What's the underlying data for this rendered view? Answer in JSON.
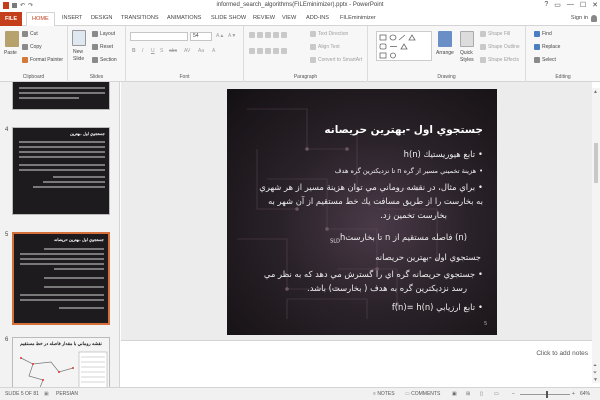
{
  "window": {
    "title": "informed_search_algorithms(FILEminimizer).pptx - PowerPoint",
    "controls": [
      "?",
      "▭",
      "—",
      "☐",
      "✕"
    ]
  },
  "tabs": [
    "FILE",
    "HOME",
    "INSERT",
    "DESIGN",
    "TRANSITIONS",
    "ANIMATIONS",
    "SLIDE SHOW",
    "REVIEW",
    "VIEW",
    "ADD-INS",
    "FILEminimizer"
  ],
  "account": {
    "sign_in": "Sign in"
  },
  "ribbon": {
    "clipboard": {
      "label": "Clipboard",
      "paste": "Paste",
      "cut": "Cut",
      "copy": "Copy",
      "format_painter": "Format Painter"
    },
    "slides": {
      "label": "Slides",
      "new_slide_line1": "New",
      "new_slide_line2": "Slide",
      "layout": "Layout",
      "reset": "Reset",
      "section": "Section"
    },
    "font": {
      "label": "Font",
      "font_size": "54",
      "bold": "B",
      "italic": "I",
      "underline": "U",
      "strike": "S",
      "shadow": "abc",
      "spacing": "AV",
      "case": "Aa",
      "color": "A"
    },
    "paragraph": {
      "label": "Paragraph",
      "text_direction": "Text Direction",
      "align_text": "Align Text",
      "convert_smartart": "Convert to SmartArt"
    },
    "drawing": {
      "label": "Drawing",
      "arrange": "Arrange",
      "quick_styles_line1": "Quick",
      "quick_styles_line2": "Styles",
      "shape_fill": "Shape Fill",
      "shape_outline": "Shape Outline",
      "shape_effects": "Shape Effects"
    },
    "editing": {
      "label": "Editing",
      "find": "Find",
      "replace": "Replace",
      "select": "Select"
    }
  },
  "thumbnails": [
    {
      "number": "",
      "title": "",
      "active": false
    },
    {
      "number": "4",
      "title": "جستجوي اول -بهترين",
      "active": false
    },
    {
      "number": "5",
      "title": "جستجوي اول -بهترين حريصانه",
      "active": true
    },
    {
      "number": "6",
      "title": "نقشه روماني با مقدار فاصله در خط مستقيم",
      "active": false
    }
  ],
  "slide": {
    "title": "جستجوي اول -بهترين حريصانه",
    "line1": "تابع هيوريستيك h(n)",
    "line2": "هزينة تخميني مسير از گره n تا نزديکترين گره هدف",
    "line3": "براي مثال، در نقشه روماني مي توان هزينة مسير از هر شهري",
    "line4": "به بخارست را از طريق مسافت يك خط مستقيم از آن شهر به",
    "line5": "بخارست تخمين زد.",
    "line6_prefix": "h",
    "line6_sub": "SLD",
    "line6_rest": "(n) فاصله مستقيم از n تا بخارست",
    "line7": "جستجوي اول -بهترين حريصانه",
    "line8": "جستجوي حريصانه گره اي را گسترش مي دهد كه به نظر مي",
    "line9": "رسد نزديكترين گره به هدف ( بخارست) باشد.",
    "line10": "تابع ارزيابي f(n)= h(n)",
    "number": "5"
  },
  "notes": {
    "placeholder": "Click to add notes"
  },
  "status": {
    "slide_info": "SLIDE 5 OF 81",
    "language": "PERSIAN",
    "notes": "NOTES",
    "comments": "COMMENTS",
    "zoom": "64%"
  }
}
